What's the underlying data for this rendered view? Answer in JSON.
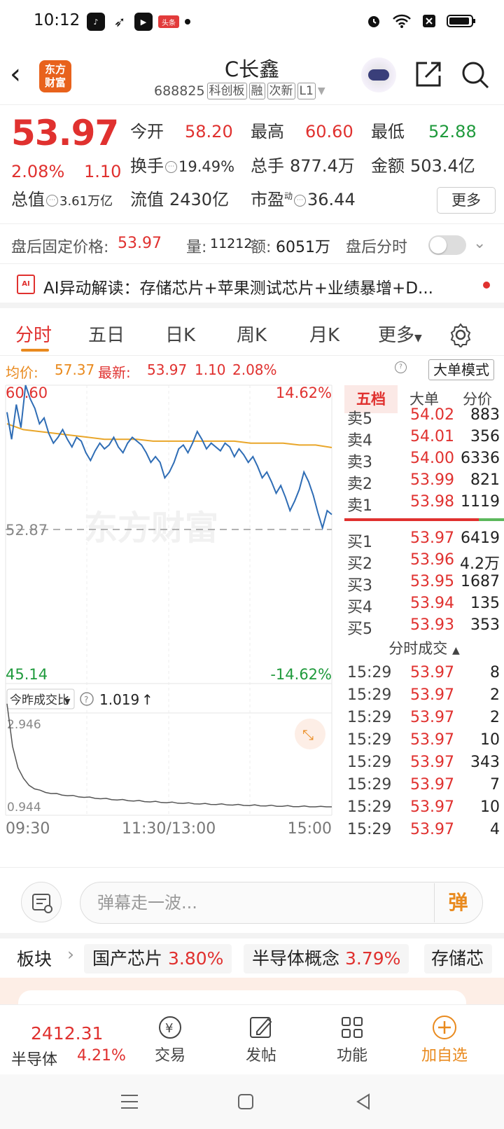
{
  "status_bar": {
    "time": "10:12",
    "badge": "头条"
  },
  "header": {
    "logo_line1": "东方",
    "logo_line2": "财富",
    "title": "C长鑫",
    "code": "688825",
    "tags": [
      "科创板",
      "融",
      "次新",
      "L1"
    ]
  },
  "quote": {
    "price": "53.97",
    "change_pct": "2.08%",
    "change_amt": "1.10",
    "open_label": "今开",
    "open": "58.20",
    "high_label": "最高",
    "high": "60.60",
    "low_label": "最低",
    "low": "52.88",
    "turnover_label": "换手",
    "turnover": "19.49%",
    "volume_label": "总手",
    "volume": "877.4万",
    "amount_label": "金额",
    "amount": "503.4亿",
    "mktcap_label": "总值",
    "mktcap": "3.61万亿",
    "float_label": "流值",
    "float": "2430亿",
    "pe_label": "市盈",
    "pe_sup": "动",
    "pe": "36.44",
    "more_btn": "更多"
  },
  "after_hours": {
    "price_label": "盘后固定价格:",
    "price": "53.97",
    "vol_label": "量:",
    "vol": "11212",
    "amt_label": "额:",
    "amt": "6051万",
    "toggle_label": "盘后分时"
  },
  "ai": {
    "text": "AI异动解读：存储芯片+苹果测试芯片+业绩暴增+D..."
  },
  "tabs": [
    "分时",
    "五日",
    "日K",
    "周K",
    "月K",
    "更多"
  ],
  "avg_line": {
    "avg_label": "均价:",
    "avg": "57.37",
    "latest_label": "最新:",
    "latest": "53.97",
    "chg": "1.10",
    "pct": "2.08%",
    "big_order_btn": "大单模式"
  },
  "chart_labels": {
    "top_price": "60.60",
    "top_pct": "14.62%",
    "prev_close": "52.87",
    "bottom_price": "45.14",
    "bottom_pct": "-14.62%",
    "watermark": "东方财富",
    "ratio_selector": "今昨成交比",
    "ratio_value": "1.019",
    "ratio_top": "2.946",
    "ratio_bottom": "0.944",
    "time_start": "09:30",
    "time_mid": "11:30/13:00",
    "time_end": "15:00"
  },
  "chart_data": {
    "type": "line",
    "ylim": [
      45.14,
      60.6
    ],
    "prev_close": 52.87,
    "price_series_approx": [
      59.2,
      57.8,
      59.6,
      58.4,
      60.6,
      59.9,
      59.4,
      58.6,
      58.9,
      58.1,
      57.6,
      57.9,
      58.3,
      57.8,
      57.4,
      57.9,
      57.7,
      57.1,
      56.7,
      57.2,
      57.6,
      57.3,
      57.5,
      57.9,
      57.4,
      57.1,
      57.6,
      57.9,
      57.7,
      57.5,
      57.1,
      56.6,
      56.9,
      56.6,
      55.8,
      56.1,
      56.6,
      57.3,
      57.5,
      57.1,
      57.6,
      58.2,
      57.8,
      57.3,
      57.6,
      57.4,
      57.2,
      57.6,
      57.4,
      56.9,
      57.3,
      57.0,
      56.6,
      56.9,
      56.4,
      55.8,
      56.1,
      55.6,
      55.0,
      55.4,
      54.8,
      54.1,
      54.6,
      55.2,
      56.1,
      55.6,
      54.9,
      54.0,
      53.2,
      54.1,
      53.9
    ],
    "avg_series_approx": [
      58.6,
      58.3,
      58.2,
      58.1,
      58.0,
      57.9,
      57.8,
      57.8,
      57.8,
      57.7,
      57.7,
      57.7,
      57.7,
      57.7,
      57.7,
      57.6,
      57.6,
      57.6,
      57.5,
      57.5,
      57.37
    ],
    "ratio_ylim": [
      0.944,
      2.946
    ]
  },
  "order_book": {
    "tabs": [
      "五档",
      "大单",
      "分价"
    ],
    "asks": [
      {
        "label": "卖5",
        "price": "54.02",
        "qty": "883"
      },
      {
        "label": "卖4",
        "price": "54.01",
        "qty": "356"
      },
      {
        "label": "卖3",
        "price": "54.00",
        "qty": "6336"
      },
      {
        "label": "卖2",
        "price": "53.99",
        "qty": "821"
      },
      {
        "label": "卖1",
        "price": "53.98",
        "qty": "1119"
      }
    ],
    "bids": [
      {
        "label": "买1",
        "price": "53.97",
        "qty": "6419"
      },
      {
        "label": "买2",
        "price": "53.96",
        "qty": "4.2万"
      },
      {
        "label": "买3",
        "price": "53.95",
        "qty": "1687"
      },
      {
        "label": "买4",
        "price": "53.94",
        "qty": "135"
      },
      {
        "label": "买5",
        "price": "53.93",
        "qty": "353"
      }
    ],
    "ticks_title": "分时成交",
    "ticks": [
      {
        "t": "15:29",
        "p": "53.97",
        "n": "8",
        "c": "green"
      },
      {
        "t": "15:29",
        "p": "53.97",
        "n": "2",
        "c": "red"
      },
      {
        "t": "15:29",
        "p": "53.97",
        "n": "2",
        "c": "red"
      },
      {
        "t": "15:29",
        "p": "53.97",
        "n": "10",
        "c": "red"
      },
      {
        "t": "15:29",
        "p": "53.97",
        "n": "343",
        "c": "green"
      },
      {
        "t": "15:29",
        "p": "53.97",
        "n": "7",
        "c": "red"
      },
      {
        "t": "15:29",
        "p": "53.97",
        "n": "10",
        "c": "green"
      },
      {
        "t": "15:29",
        "p": "53.97",
        "n": "4",
        "c": "green"
      }
    ]
  },
  "danmu": {
    "placeholder": "弹幕走一波...",
    "send": "弹"
  },
  "sectors": {
    "label": "板块",
    "items": [
      {
        "name": "国产芯片",
        "pct": "3.80%"
      },
      {
        "name": "半导体概念",
        "pct": "3.79%"
      },
      {
        "name": "存储芯",
        "pct": ""
      }
    ]
  },
  "bottom_nav": {
    "index_value": "2412.31",
    "index_name": "半导体",
    "index_pct": "4.21%",
    "items": [
      "交易",
      "发帖",
      "功能",
      "加自选"
    ]
  },
  "colors": {
    "up": "#e0312f",
    "down": "#1f9a3c",
    "accent": "#e98a1e",
    "price_line": "#2f6db5",
    "avg_line": "#e9a62a"
  }
}
